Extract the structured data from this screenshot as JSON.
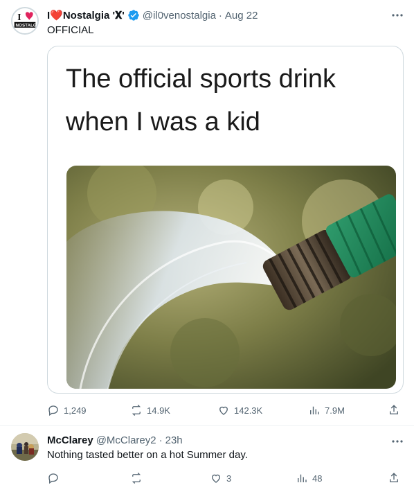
{
  "tweet": {
    "display_name": "I❤️Nostalgia '𝐗'",
    "handle": "@il0venostalgia",
    "separator": "·",
    "time": "Aug 22",
    "text": "OFFICIAL",
    "avatar_text_top": "I",
    "avatar_text_bottom": "NOSTALGIA",
    "media": {
      "caption": "The official sports drink when I was a kid"
    },
    "actions": {
      "replies": "1,249",
      "reposts": "14.9K",
      "likes": "142.3K",
      "views": "7.9M"
    },
    "verified_color": "#1d9bf0"
  },
  "reply": {
    "display_name": "McClarey",
    "handle": "@McClarey2",
    "separator": "·",
    "time": "23h",
    "text": "Nothing tasted better on a hot Summer day.",
    "actions": {
      "replies": "",
      "reposts": "",
      "likes": "3",
      "views": "48"
    }
  },
  "icons": {
    "more": "more-icon",
    "reply": "reply-icon",
    "repost": "repost-icon",
    "like": "like-icon",
    "views": "views-icon",
    "share": "share-icon"
  }
}
